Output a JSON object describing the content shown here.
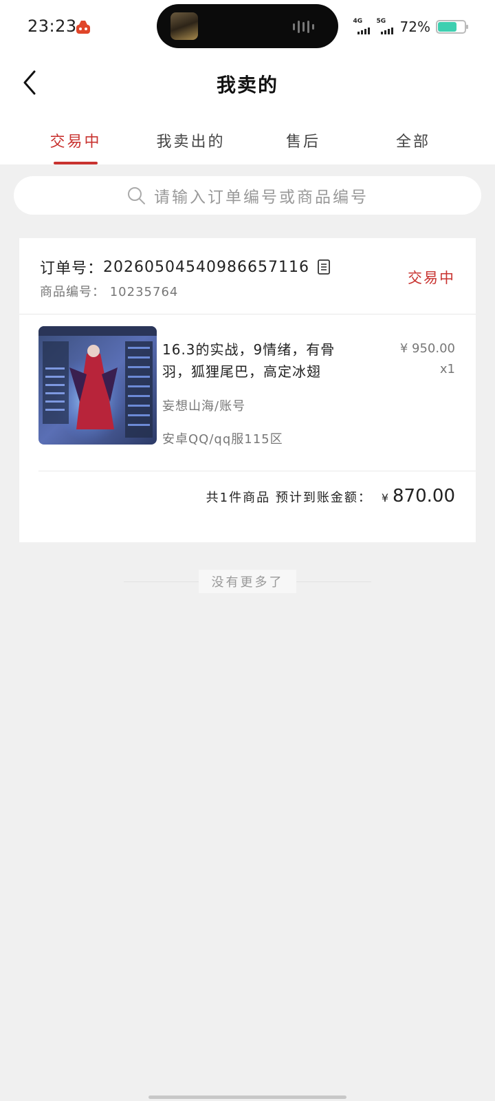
{
  "status_bar": {
    "time": "23:23",
    "app_icon": "car-icon",
    "network1": "4G",
    "network2": "5G",
    "battery_percent": "72%",
    "battery_level": 0.72,
    "battery_color": "#3ecfb0"
  },
  "header": {
    "title": "我卖的",
    "back_icon": "chevron-left-icon"
  },
  "tabs": [
    {
      "label": "交易中",
      "active": true
    },
    {
      "label": "我卖出的",
      "active": false
    },
    {
      "label": "售后",
      "active": false
    },
    {
      "label": "全部",
      "active": false
    }
  ],
  "search": {
    "placeholder": "请输入订单编号或商品编号",
    "icon": "search-icon"
  },
  "order": {
    "order_no_label": "订单号：",
    "order_no": "20260504540986657116",
    "product_code_label": "商品编号：",
    "product_code": "10235764",
    "status": "交易中",
    "item": {
      "title": "16.3的实战，9情绪，有骨羽，狐狸尾巴，高定冰翅",
      "price": "¥ 950.00",
      "quantity": "x1",
      "game": "妄想山海/账号",
      "server": "安卓QQ/qq服115区"
    },
    "total_label": "共1件商品 预计到账金额：",
    "total_currency": "¥",
    "total_amount": "870.00"
  },
  "footer": {
    "no_more": "没有更多了"
  },
  "colors": {
    "accent": "#c8322f",
    "background": "#f0f0f0"
  }
}
